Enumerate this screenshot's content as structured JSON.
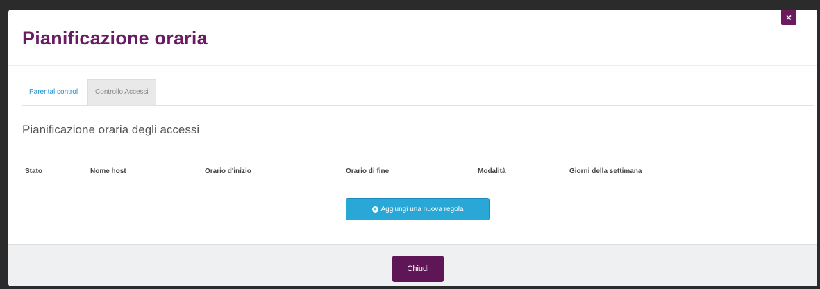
{
  "modal": {
    "title": "Pianificazione oraria",
    "close_icon": "close-icon",
    "close_glyph": "×"
  },
  "tabs": [
    {
      "label": "Parental control",
      "active": true
    },
    {
      "label": "Controllo Accessi",
      "active": false
    }
  ],
  "section": {
    "title": "Pianificazione oraria degli accessi"
  },
  "table": {
    "columns": [
      "Stato",
      "Nome host",
      "Orario d'inizio",
      "Orario di fine",
      "Modalità",
      "Giorni della settimana"
    ]
  },
  "add_rule_button": {
    "icon": "plus-circle-icon",
    "label": "Aggiungi una nuova regola"
  },
  "footer": {
    "close_label": "Chiudi"
  },
  "colors": {
    "title": "#6a1b63",
    "accent_button": "#29a8d8",
    "primary_button": "#5f1656",
    "active_tab": "#1f8fce"
  }
}
